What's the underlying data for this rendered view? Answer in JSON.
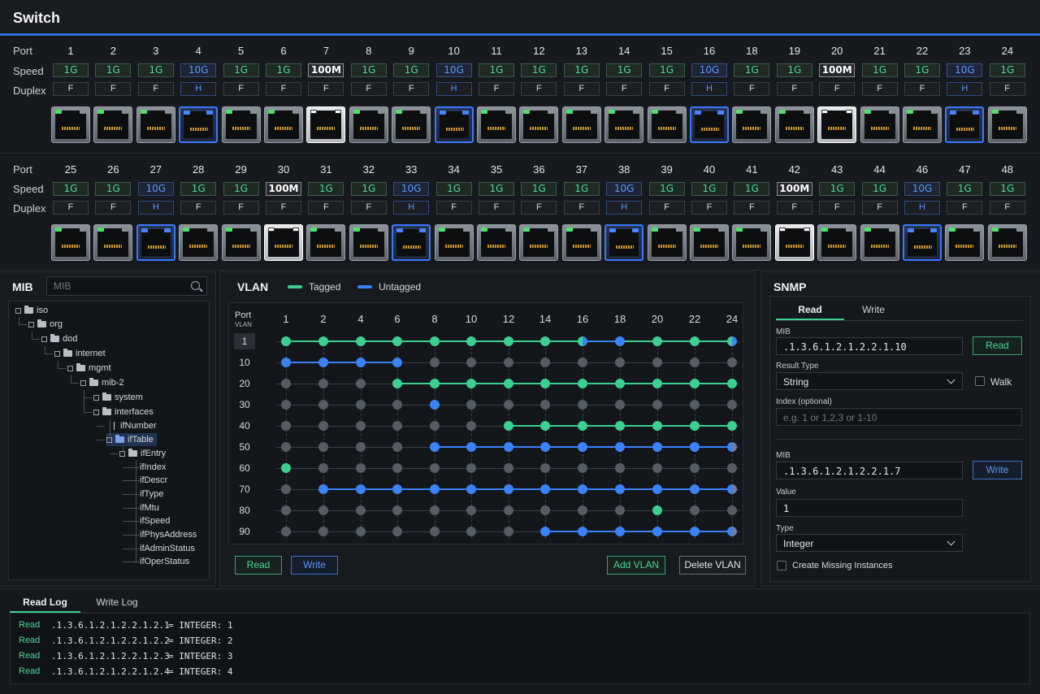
{
  "app": {
    "title": "Switch"
  },
  "ports": {
    "labels": {
      "port": "Port",
      "speed": "Speed",
      "duplex": "Duplex"
    },
    "top": [
      {
        "num": "1",
        "speed": "1G",
        "duplex": "F"
      },
      {
        "num": "2",
        "speed": "1G",
        "duplex": "F"
      },
      {
        "num": "3",
        "speed": "1G",
        "duplex": "F"
      },
      {
        "num": "4",
        "speed": "10G",
        "duplex": "H"
      },
      {
        "num": "5",
        "speed": "1G",
        "duplex": "F"
      },
      {
        "num": "6",
        "speed": "1G",
        "duplex": "F"
      },
      {
        "num": "7",
        "speed": "100M",
        "duplex": "F"
      },
      {
        "num": "8",
        "speed": "1G",
        "duplex": "F"
      },
      {
        "num": "9",
        "speed": "1G",
        "duplex": "F"
      },
      {
        "num": "10",
        "speed": "10G",
        "duplex": "H"
      },
      {
        "num": "11",
        "speed": "1G",
        "duplex": "F"
      },
      {
        "num": "12",
        "speed": "1G",
        "duplex": "F"
      },
      {
        "num": "13",
        "speed": "1G",
        "duplex": "F"
      },
      {
        "num": "14",
        "speed": "1G",
        "duplex": "F"
      },
      {
        "num": "15",
        "speed": "1G",
        "duplex": "F"
      },
      {
        "num": "16",
        "speed": "10G",
        "duplex": "H"
      },
      {
        "num": "18",
        "speed": "1G",
        "duplex": "F"
      },
      {
        "num": "19",
        "speed": "1G",
        "duplex": "F"
      },
      {
        "num": "20",
        "speed": "100M",
        "duplex": "F"
      },
      {
        "num": "21",
        "speed": "1G",
        "duplex": "F"
      },
      {
        "num": "22",
        "speed": "1G",
        "duplex": "F"
      },
      {
        "num": "23",
        "speed": "10G",
        "duplex": "H"
      },
      {
        "num": "24",
        "speed": "1G",
        "duplex": "F"
      }
    ],
    "bottom": [
      {
        "num": "25",
        "speed": "1G",
        "duplex": "F"
      },
      {
        "num": "26",
        "speed": "1G",
        "duplex": "F"
      },
      {
        "num": "27",
        "speed": "10G",
        "duplex": "H"
      },
      {
        "num": "28",
        "speed": "1G",
        "duplex": "F"
      },
      {
        "num": "29",
        "speed": "1G",
        "duplex": "F"
      },
      {
        "num": "30",
        "speed": "100M",
        "duplex": "F"
      },
      {
        "num": "31",
        "speed": "1G",
        "duplex": "F"
      },
      {
        "num": "32",
        "speed": "1G",
        "duplex": "F"
      },
      {
        "num": "33",
        "speed": "10G",
        "duplex": "H"
      },
      {
        "num": "34",
        "speed": "1G",
        "duplex": "F"
      },
      {
        "num": "35",
        "speed": "1G",
        "duplex": "F"
      },
      {
        "num": "36",
        "speed": "1G",
        "duplex": "F"
      },
      {
        "num": "37",
        "speed": "1G",
        "duplex": "F"
      },
      {
        "num": "38",
        "speed": "10G",
        "duplex": "H"
      },
      {
        "num": "39",
        "speed": "1G",
        "duplex": "F"
      },
      {
        "num": "40",
        "speed": "1G",
        "duplex": "F"
      },
      {
        "num": "41",
        "speed": "1G",
        "duplex": "F"
      },
      {
        "num": "42",
        "speed": "100M",
        "duplex": "F"
      },
      {
        "num": "43",
        "speed": "1G",
        "duplex": "F"
      },
      {
        "num": "44",
        "speed": "1G",
        "duplex": "F"
      },
      {
        "num": "46",
        "speed": "10G",
        "duplex": "H"
      },
      {
        "num": "47",
        "speed": "1G",
        "duplex": "F"
      },
      {
        "num": "48",
        "speed": "1G",
        "duplex": "F"
      }
    ]
  },
  "mib": {
    "title": "MIB",
    "search_placeholder": "MIB",
    "tree": [
      {
        "label": "iso",
        "depth": 0,
        "kind": "folder"
      },
      {
        "label": "org",
        "depth": 1,
        "kind": "folder"
      },
      {
        "label": "dod",
        "depth": 2,
        "kind": "folder"
      },
      {
        "label": "internet",
        "depth": 3,
        "kind": "folder"
      },
      {
        "label": "mgmt",
        "depth": 4,
        "kind": "folder"
      },
      {
        "label": "mib-2",
        "depth": 5,
        "kind": "folder"
      },
      {
        "label": "system",
        "depth": 6,
        "kind": "folder"
      },
      {
        "label": "interfaces",
        "depth": 6,
        "kind": "folder"
      },
      {
        "label": "ifNumber",
        "depth": 7,
        "kind": "leafbar"
      },
      {
        "label": "ifTable",
        "depth": 7,
        "kind": "open",
        "selected": true
      },
      {
        "label": "ifEntry",
        "depth": 8,
        "kind": "folder"
      },
      {
        "label": "ifIndex",
        "depth": 9,
        "kind": "leaf"
      },
      {
        "label": "ifDescr",
        "depth": 9,
        "kind": "leaf"
      },
      {
        "label": "ifType",
        "depth": 9,
        "kind": "leaf"
      },
      {
        "label": "ifMtu",
        "depth": 9,
        "kind": "leaf"
      },
      {
        "label": "ifSpeed",
        "depth": 9,
        "kind": "leaf"
      },
      {
        "label": "ifPhysAddress",
        "depth": 9,
        "kind": "leaf"
      },
      {
        "label": "ifAdminStatus",
        "depth": 9,
        "kind": "leaf"
      },
      {
        "label": "ifOperStatus",
        "depth": 9,
        "kind": "leaf"
      }
    ]
  },
  "vlan": {
    "title": "VLAN",
    "legend_tagged": "Tagged",
    "legend_untagged": "Untagged",
    "header_port": "Port",
    "header_vlan": "VLAN",
    "ports": [
      "1",
      "2",
      "4",
      "6",
      "8",
      "10",
      "12",
      "14",
      "16",
      "18",
      "20",
      "22",
      "24"
    ],
    "rows": [
      {
        "vlan": "1",
        "cells": "TTTTTTTTHUTTH"
      },
      {
        "vlan": "10",
        "cells": "UUUUNNNNNNNNN"
      },
      {
        "vlan": "20",
        "cells": "NNNTTTTTTTTTT"
      },
      {
        "vlan": "30",
        "cells": "NNNNUNNNNNNNN"
      },
      {
        "vlan": "40",
        "cells": "NNNNNNTTTTTTT"
      },
      {
        "vlan": "50",
        "cells": "NNNNUUUUUUUUH"
      },
      {
        "vlan": "60",
        "cells": "TNNNNNNNNNNNN"
      },
      {
        "vlan": "70",
        "cells": "NUUUUUUUUUUUH"
      },
      {
        "vlan": "80",
        "cells": "NNNNNNNNNNTNN"
      },
      {
        "vlan": "90",
        "cells": "NNNNNNNUUUUUH"
      }
    ],
    "read_label": "Read",
    "write_label": "Write",
    "add_label": "Add VLAN",
    "delete_label": "Delete VLAN"
  },
  "snmp": {
    "title": "SNMP",
    "tab_read": "Read",
    "tab_write": "Write",
    "read": {
      "mib_label": "MIB",
      "mib_value": ".1.3.6.1.2.1.2.2.1.10",
      "read_button": "Read",
      "result_type_label": "Result Type",
      "result_type_value": "String",
      "walk_label": "Walk",
      "index_label": "Index (optional)",
      "index_placeholder": "e.g. 1 or 1,2,3 or 1-10"
    },
    "write": {
      "mib_label": "MIB",
      "mib_value": ".1.3.6.1.2.1.2.2.1.7",
      "write_button": "Write",
      "value_label": "Value",
      "value_value": "1",
      "type_label": "Type",
      "type_value": "Integer",
      "create_label": "Create Missing Instances"
    }
  },
  "log": {
    "tab_read": "Read Log",
    "tab_write": "Write Log",
    "lines": [
      {
        "tag": "Read",
        "oid": ".1.3.6.1.2.1.2.2.1.2.1",
        "value": "= INTEGER: 1"
      },
      {
        "tag": "Read",
        "oid": ".1.3.6.1.2.1.2.2.1.2.2",
        "value": "= INTEGER: 2"
      },
      {
        "tag": "Read",
        "oid": ".1.3.6.1.2.1.2.2.1.2.3",
        "value": "= INTEGER: 3"
      },
      {
        "tag": "Read",
        "oid": ".1.3.6.1.2.1.2.2.1.2.4",
        "value": "= INTEGER: 4"
      }
    ]
  },
  "colors": {
    "tagged": "#3ccf91",
    "untagged": "#3b82f6",
    "none": "#565c64",
    "accent": "#2f6fe0"
  }
}
